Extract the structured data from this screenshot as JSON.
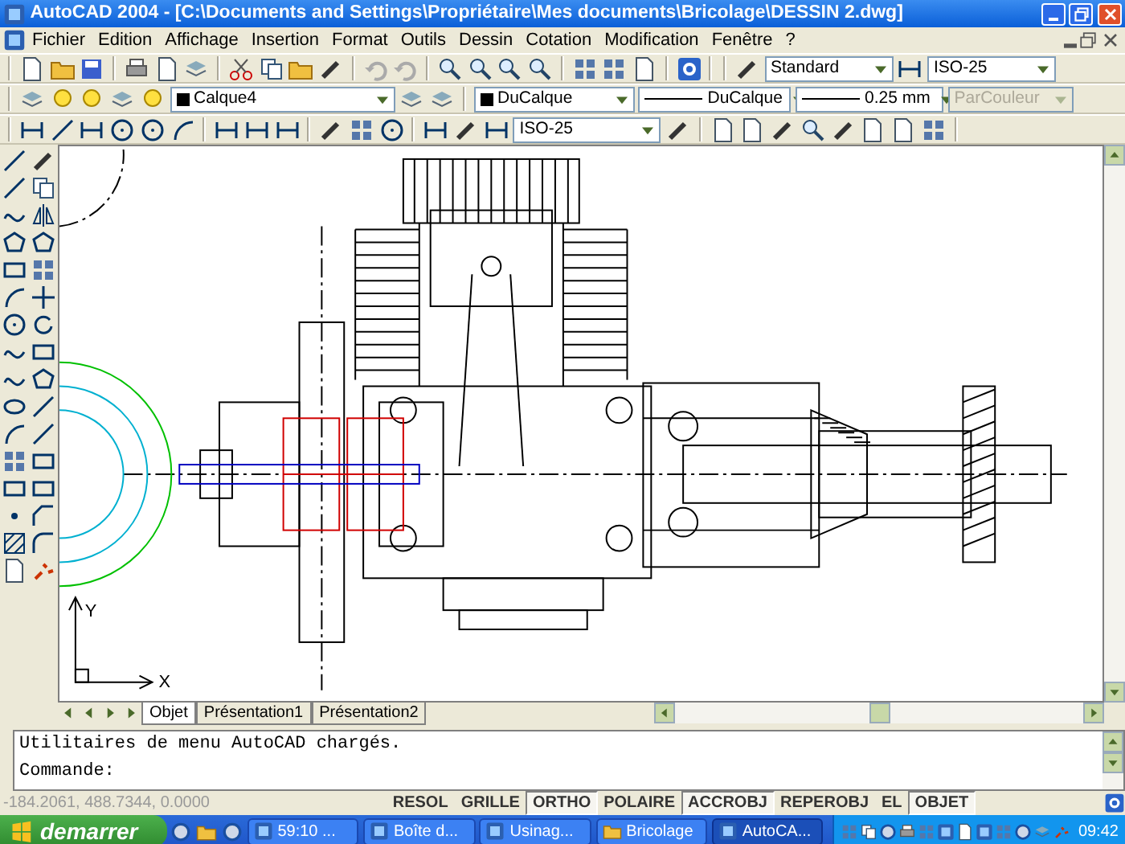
{
  "window": {
    "title": "AutoCAD 2004 - [C:\\Documents and Settings\\Propriétaire\\Mes documents\\Bricolage\\DESSIN 2.dwg]"
  },
  "menu": [
    "Fichier",
    "Edition",
    "Affichage",
    "Insertion",
    "Format",
    "Outils",
    "Dessin",
    "Cotation",
    "Modification",
    "Fenêtre",
    "?"
  ],
  "styles_toolbar": {
    "text_style": "Standard",
    "dim_style": "ISO-25"
  },
  "properties_toolbar": {
    "layer": "Calque4",
    "color_setting": "DuCalque",
    "linetype": "DuCalque",
    "lineweight": "0.25 mm",
    "plot_style": "ParCouleur",
    "plot_style_disabled": true
  },
  "dimension_toolbar": {
    "dim_style": "ISO-25"
  },
  "ucs_icon": {
    "y_label": "Y",
    "x_label": "X"
  },
  "layout_tabs": [
    {
      "label": "Objet",
      "selected": true
    },
    {
      "label": "Présentation1",
      "selected": false
    },
    {
      "label": "Présentation2",
      "selected": false
    }
  ],
  "command_line": {
    "history": "Utilitaires de menu AutoCAD chargés.",
    "prompt": "Commande:"
  },
  "status_bar": {
    "coordinates": "-184.2061, 488.7344, 0.0000",
    "toggles": [
      {
        "label": "RESOL",
        "on": false
      },
      {
        "label": "GRILLE",
        "on": false
      },
      {
        "label": "ORTHO",
        "on": true
      },
      {
        "label": "POLAIRE",
        "on": false
      },
      {
        "label": "ACCROBJ",
        "on": true
      },
      {
        "label": "REPEROBJ",
        "on": false
      },
      {
        "label": "EL",
        "on": false
      },
      {
        "label": "OBJET",
        "on": true
      }
    ]
  },
  "taskbar": {
    "start": "demarrer",
    "tasks": [
      {
        "label": "59:10 ...",
        "selected": false
      },
      {
        "label": "Boîte d...",
        "selected": false
      },
      {
        "label": "Usinag...",
        "selected": false
      },
      {
        "label": "Bricolage",
        "selected": false
      },
      {
        "label": "AutoCA...",
        "selected": true
      }
    ],
    "clock": "09:42"
  }
}
